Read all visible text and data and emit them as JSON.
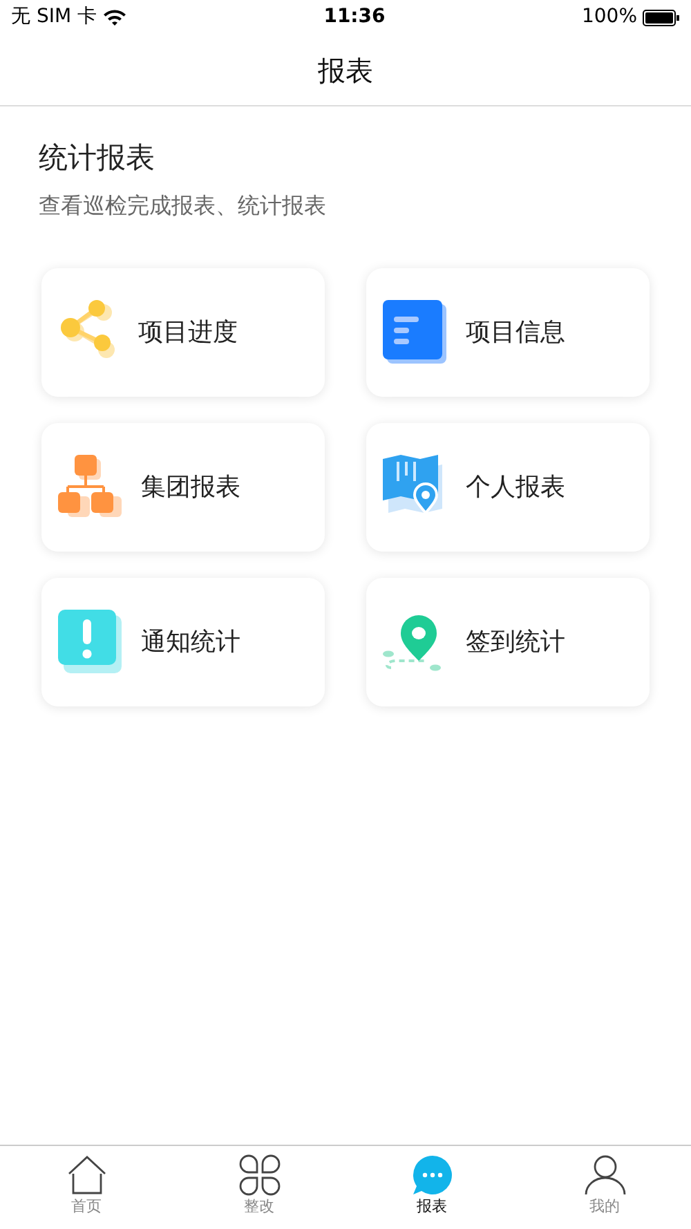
{
  "status_bar": {
    "carrier": "无 SIM 卡",
    "time": "11:36",
    "battery": "100%"
  },
  "nav": {
    "title": "报表"
  },
  "section": {
    "title": "统计报表",
    "subtitle": "查看巡检完成报表、统计报表"
  },
  "cards": [
    {
      "label": "项目进度",
      "kind": "share"
    },
    {
      "label": "项目信息",
      "kind": "doc"
    },
    {
      "label": "集团报表",
      "kind": "org"
    },
    {
      "label": "个人报表",
      "kind": "map"
    },
    {
      "label": "通知统计",
      "kind": "alert"
    },
    {
      "label": "签到统计",
      "kind": "pin"
    }
  ],
  "tabs": [
    {
      "label": "首页",
      "kind": "home",
      "selected": false
    },
    {
      "label": "整改",
      "kind": "clover",
      "selected": false
    },
    {
      "label": "报表",
      "kind": "chat",
      "selected": true
    },
    {
      "label": "我的",
      "kind": "user",
      "selected": false
    }
  ]
}
